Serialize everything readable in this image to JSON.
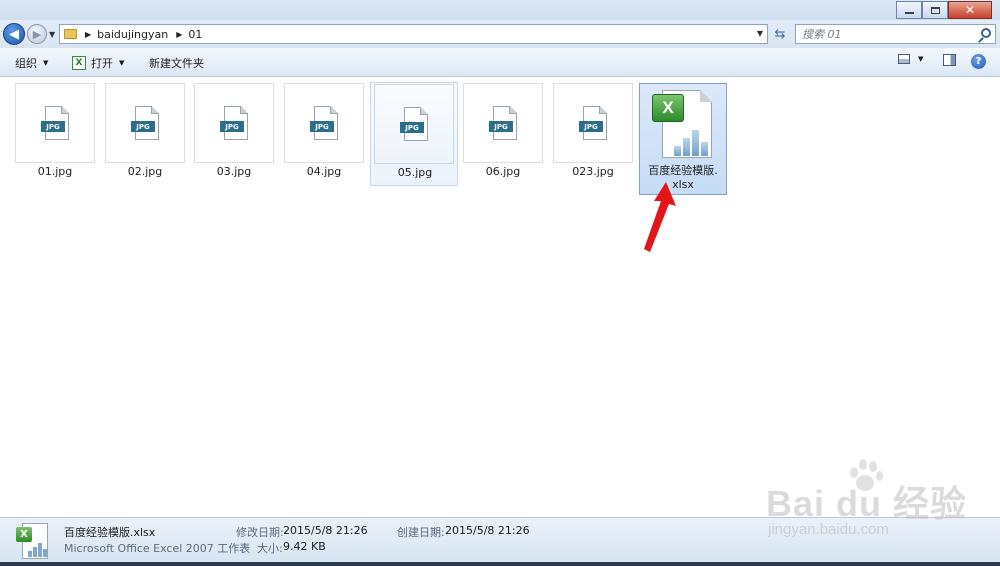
{
  "window": {
    "minimize_glyph": "",
    "maximize_glyph": "",
    "close_glyph": "✕"
  },
  "nav": {
    "breadcrumbs": [
      "baidujingyan",
      "01"
    ],
    "search_placeholder": "搜索 01"
  },
  "toolbar": {
    "organize_label": "组织",
    "open_label": "打开",
    "new_folder_label": "新建文件夹"
  },
  "files": [
    {
      "name": "01.jpg",
      "type_tag": "JPG"
    },
    {
      "name": "02.jpg",
      "type_tag": "JPG"
    },
    {
      "name": "03.jpg",
      "type_tag": "JPG"
    },
    {
      "name": "04.jpg",
      "type_tag": "JPG"
    },
    {
      "name": "05.jpg",
      "type_tag": "JPG"
    },
    {
      "name": "06.jpg",
      "type_tag": "JPG"
    },
    {
      "name": "023.jpg",
      "type_tag": "JPG"
    }
  ],
  "selected_file": {
    "name_line1": "百度经验模版.",
    "name_line2": "xlsx",
    "badge_letter": "X"
  },
  "details": {
    "file_name": "百度经验模版.xlsx",
    "file_type": "Microsoft Office Excel 2007 工作表",
    "modified_label": "修改日期:",
    "modified_value": "2015/5/8 21:26",
    "size_label": "大小:",
    "size_value": "9.42 KB",
    "created_label": "创建日期:",
    "created_value": "2015/5/8 21:26"
  },
  "watermark": {
    "brand": "Bai  du 经验",
    "sub": "jingyan.baidu.com"
  },
  "colors": {
    "accent": "#1c56b0",
    "selection": "#c6dcf5",
    "arrow": "#e0161b",
    "excel_green": "#2f8a2c"
  }
}
